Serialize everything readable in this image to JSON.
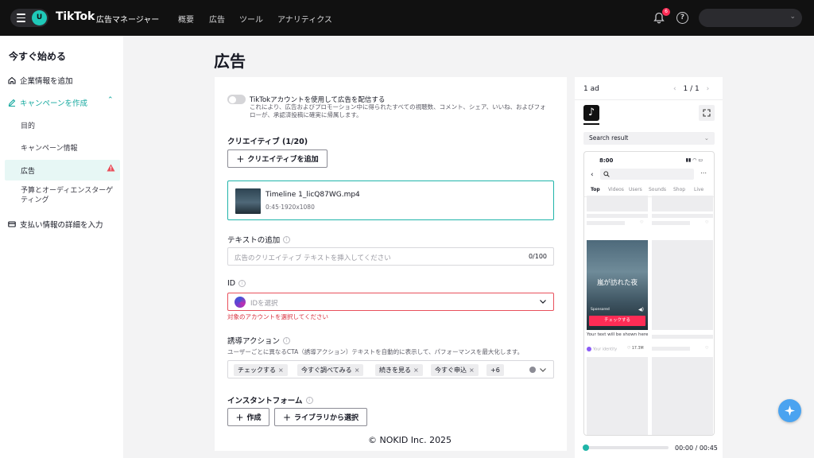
{
  "header": {
    "user_initial": "U",
    "logo": "TikTok",
    "logo_sub": "広告マネージャー",
    "nav": [
      "概要",
      "広告",
      "ツール",
      "アナリティクス"
    ],
    "notification_count": "6",
    "help_glyph": "?"
  },
  "sidebar": {
    "title": "今すぐ始める",
    "items": [
      {
        "label": "企業情報を追加",
        "icon": "home-icon"
      },
      {
        "label": "キャンペーンを作成",
        "icon": "edit-icon"
      },
      {
        "label": "目的"
      },
      {
        "label": "キャンペーン情報"
      },
      {
        "label": "広告",
        "status": "warning"
      },
      {
        "label": "予算とオーディエンスターゲティング"
      },
      {
        "label": "支払い情報の詳細を入力",
        "icon": "card-icon"
      }
    ]
  },
  "main": {
    "page_title": "広告",
    "toggle": {
      "title": "TikTokアカウントを使用して広告を配信する",
      "desc": "これにより、広告およびプロモーション中に得られたすべての視聴数、コメント、シェア、いいね、およびフォローが、承認済投稿に確実に帰属します。",
      "on": false
    },
    "creative": {
      "label": "クリエイティブ (1/20)",
      "add_button": "クリエイティブを追加",
      "file_name": "Timeline 1_licQ87WG.mp4",
      "file_meta": "0:45·1920x1080"
    },
    "text": {
      "label": "テキストの追加",
      "placeholder": "広告のクリエイティブ テキストを挿入してください",
      "counter": "0/100"
    },
    "identity": {
      "label": "ID",
      "placeholder": "IDを選択",
      "error": "対象のアカウントを選択してください"
    },
    "cta": {
      "label": "誘導アクション",
      "desc": "ユーザーごとに異なるCTA（誘導アクション）テキストを自動的に表示して、パフォーマンスを最大化します。",
      "tags": [
        "チェックする",
        "今すぐ調べてみる",
        "続きを見る",
        "今すぐ申込"
      ],
      "more": "+6"
    },
    "instant_form": {
      "label": "インスタントフォーム",
      "create_button": "作成",
      "library_button": "ライブラリから選択"
    },
    "copyright": "© NOKID Inc. 2025"
  },
  "preview": {
    "count": "1 ad",
    "page_current": "1",
    "page_sep": "/",
    "page_total": "1",
    "placement": "Search result",
    "phone": {
      "time": "8:00",
      "tabs": [
        "Top",
        "Videos",
        "Users",
        "Sounds",
        "Shop",
        "Live"
      ],
      "ad_title": "嵐が訪れた夜",
      "sponsored": "Sponsored",
      "cta": "チェックする",
      "ad_text": "Your text will be shown here",
      "identity": "Your identity",
      "likes": "17.3M"
    },
    "time": "00:00 / 00:45",
    "progress": 0
  },
  "colors": {
    "accent": "#1fb5a8",
    "error": "#e9505c",
    "cta": "#fe2c55",
    "topbar": "#111111"
  }
}
